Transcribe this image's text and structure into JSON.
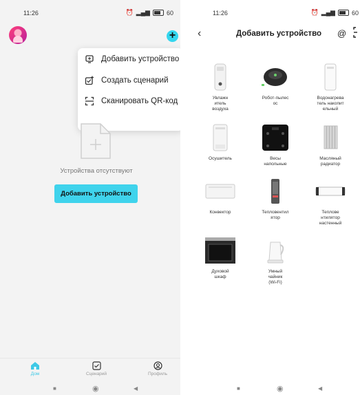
{
  "left": {
    "status": {
      "time": "11:26",
      "battery": "60"
    },
    "popup": {
      "items": [
        {
          "label": "Добавить устройство",
          "icon": "add-device-icon"
        },
        {
          "label": "Создать сценарий",
          "icon": "create-scene-icon"
        },
        {
          "label": "Сканировать QR-код",
          "icon": "scan-qr-icon"
        }
      ]
    },
    "empty_text": "Устройства отсутствуют",
    "add_button": "Добавить устройство",
    "tabs": [
      {
        "label": "Дом",
        "icon": "home-icon"
      },
      {
        "label": "Сценарий",
        "icon": "scenario-icon"
      },
      {
        "label": "Профиль",
        "icon": "profile-icon"
      }
    ],
    "accent": "#3fd3ec"
  },
  "right": {
    "status": {
      "time": "11:26",
      "battery": "60"
    },
    "title": "Добавить устройство",
    "devices": [
      {
        "label": "Увлажн\nитель\nвоздуха",
        "icon": "humidifier-icon"
      },
      {
        "label": "Робот-пылес\nос",
        "icon": "robot-vacuum-icon"
      },
      {
        "label": "Водонагрева\nтель накопит\nельный",
        "icon": "water-heater-icon"
      },
      {
        "label": "Осушитель",
        "icon": "dehumidifier-icon"
      },
      {
        "label": "Весы\nнапольные",
        "icon": "scale-icon"
      },
      {
        "label": "Масляный\nрадиатор",
        "icon": "oil-radiator-icon"
      },
      {
        "label": "Конвектор",
        "icon": "convector-icon"
      },
      {
        "label": "Тепловентил\nятор",
        "icon": "fan-heater-icon"
      },
      {
        "label": "Теплове\nнтилятор\nнастенный",
        "icon": "wall-heater-icon"
      },
      {
        "label": "Духовой\nшкаф",
        "icon": "oven-icon"
      },
      {
        "label": "Умный\nчайник\n(Wi-Fi)",
        "icon": "kettle-icon"
      }
    ]
  }
}
